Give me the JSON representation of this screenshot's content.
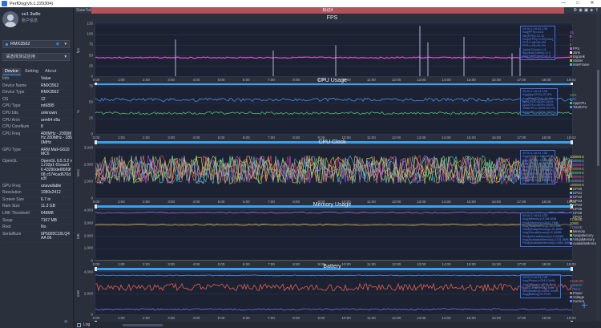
{
  "window": {
    "title": "PerfDog(v6.1.220304)",
    "controls": [
      "—",
      "□",
      "✕"
    ]
  },
  "sidebar": {
    "user": {
      "name": "xe1 3w8e",
      "center": "账户信息"
    },
    "device": {
      "name": "RMX3562"
    },
    "app_placeholder": "请选择测试应用",
    "tabs": [
      "Device",
      "Setting",
      "About"
    ],
    "info_header": {
      "k": "Info",
      "v": "Value"
    },
    "info": [
      {
        "k": "Device Name",
        "v": "RMX3562"
      },
      {
        "k": "Device Type",
        "v": "RMX3562"
      },
      {
        "k": "OS",
        "v": "12"
      },
      {
        "k": "CPU Type",
        "v": "mt6895"
      },
      {
        "k": "CPU bits",
        "v": "unknown"
      },
      {
        "k": "CPU Arch",
        "v": "arm64-v8a"
      },
      {
        "k": "CPU CoreNum",
        "v": "8"
      },
      {
        "k": "CPU Freq",
        "v": "400MHz - 2000MHz 200MHz - 2850MHz"
      },
      {
        "k": "GPU Type",
        "v": "ARM Mali-G610 MC6"
      },
      {
        "k": "OpenGL",
        "v": "OpenGL ES 3.2 v1.r32p1-01eac0.6 43290de6f069f08 c574cad670de3f"
      },
      {
        "k": "GPU Freq",
        "v": "unavailable"
      },
      {
        "k": "Resolution",
        "v": "1080x2412"
      },
      {
        "k": "Screen Size",
        "v": "6.7 in"
      },
      {
        "k": "Ram Size",
        "v": "11.3 GB"
      },
      {
        "k": "LMK Threshold",
        "v": "648MB"
      },
      {
        "k": "Swap",
        "v": "7167 MB"
      },
      {
        "k": "Root",
        "v": "No"
      },
      {
        "k": "SerialNum",
        "v": "6P5005C10LQ4AA 06"
      }
    ]
  },
  "main": {
    "state_tab": "StateTab",
    "record_tag": "标记4",
    "x_ticks": [
      "0:00",
      "1:00",
      "2:00",
      "3:00",
      "4:00",
      "5:00",
      "6:00",
      "7:00",
      "8:00",
      "9:00",
      "10:00",
      "11:00",
      "12:00",
      "13:00",
      "14:00",
      "15:00",
      "16:00",
      "17:00",
      "18:00",
      "19:03"
    ],
    "panels": [
      {
        "title": "FPS",
        "ylabel": "fps",
        "yticks": [
          "125",
          "100",
          "75",
          "50",
          "25",
          "0"
        ],
        "stats": [
          "00:00-1:16:41.138",
          "Avg(FPS)=44.8",
          "Var(FPS)=12.11",
          "Drop(FPS)=0.90[/10m]",
          "FPS>=18=99.3%",
          "FPS>=25=99.0%",
          "Jank(/10min)=1.6",
          "BigJank(/10min)=0.4",
          "Avg(InterFrame)=0.0"
        ],
        "legend": [
          {
            "value": "45",
            "label": "FPS",
            "color": "#e04fd8"
          },
          {
            "value": "0",
            "label": "Jank",
            "color": "#e8e8e8"
          },
          {
            "value": "0",
            "label": "BigJank",
            "color": "#d94a4a"
          },
          {
            "value": "0",
            "label": "Stutter",
            "color": "#8fd14f"
          },
          {
            "value": "",
            "label": "InterFrame",
            "color": "#4ab0e8"
          }
        ]
      },
      {
        "title": "CPU Usage",
        "ylabel": "%",
        "yticks": [
          "75",
          "50",
          "25",
          "0"
        ],
        "stats": [
          "00:00-1:16:41.138",
          "Avg(AppCPU)=22.8%",
          "Avg(TotalCPU)=45.4%",
          "AppCPU<=60%=100%",
          "AppCPU<=80%=100%",
          "TotalCPU<=60%=99.7%",
          "TotalCPU<=80%=100%"
        ],
        "legend": [
          {
            "value": "23%",
            "label": "AppCPU",
            "color": "#4fbf6f"
          },
          {
            "value": "48%",
            "label": "TotalCPU",
            "color": "#4a8ff0"
          }
        ]
      },
      {
        "title": "CPU Clock",
        "ylabel": "MHz",
        "yticks": [
          "3,000",
          "2,000",
          "1,000",
          "0"
        ],
        "stats": [
          "00:00-1:16:41.138",
          "Avg(CPU0)=1482MHz",
          "Avg(CPU1)=1482MHz",
          "Avg(CPU2)=1482MHz",
          "Avg(CPU3)=1482MHz",
          "Avg(CPU4)=1729MHz",
          "Avg(CPU5)=1729MHz",
          "Avg(CPU6)=1729MHz",
          "Avg(CPU7)=1729MHz"
        ],
        "legend": [
          {
            "value": "1000MHz",
            "label": "CPU0",
            "color": "#e0e04f"
          },
          {
            "value": "1000MHz",
            "label": "CPU1",
            "color": "#4fbfe0"
          },
          {
            "value": "1000MHz",
            "label": "CPU2",
            "color": "#bf4fe0"
          },
          {
            "value": "1000MHz",
            "label": "CPU3",
            "color": "#e08c4f"
          },
          {
            "value": "1600MHz",
            "label": "CPU4",
            "color": "#4fe0a0"
          },
          {
            "value": "1600MHz",
            "label": "CPU5",
            "color": "#e04f6f"
          },
          {
            "value": "1600MHz",
            "label": "CPU6",
            "color": "#8f8fe8"
          },
          {
            "value": "1600MHz",
            "label": "CPU7",
            "color": "#c8c84f"
          }
        ]
      },
      {
        "title": "Memory Usage",
        "ylabel": "MB",
        "yticks": [
          "4,000",
          "3,000",
          "2,000",
          "1,000",
          "0"
        ],
        "stats": [
          "00:00-1:16:41.138",
          "Avg(Memory)=3748.5MB",
          "Peak(Memory)=3917.7MB",
          "Avg(SwapMemory)=30.1MB",
          "Peak(SwapMemory)=31.8MB",
          "Avg(VirtualMemory)=2.40MB",
          "Peak(VirtualMemory)=3.00MB",
          "Avg(AvailableMemory)=2761.3MB",
          "Peak(AvailableMemory)=2980.3MB"
        ],
        "legend": [
          {
            "value": "3748MB",
            "label": "Memory",
            "color": "#e6c74f"
          },
          {
            "value": "30MB",
            "label": "SwapMemory",
            "color": "#8fd14f"
          },
          {
            "value": "",
            "label": "VirtualMemory",
            "color": "#4ab0e8"
          },
          {
            "value": "4745MB",
            "label": "AvailableMemory",
            "color": "#9d6fe0"
          }
        ]
      },
      {
        "title": "Battery",
        "ylabel": "mW",
        "yticks": [
          "4,000",
          "2,000",
          "0"
        ],
        "stats": [
          "00:00-1:16:41.138",
          "Avg(Power)=2341.0mW",
          "Avg(Voltage)=4020.7mV",
          "Avg(Current)=582.3mA",
          "Sum(Battery)=3104.7mWh",
          "Avg(Battery)=5.7%/h"
        ],
        "legend": [
          {
            "value": "2324mW",
            "label": "Power",
            "color": "#e0604f"
          },
          {
            "value": "4015mV",
            "label": "Voltage",
            "color": "#4a8ff0"
          },
          {
            "value": "579mA",
            "label": "Current",
            "color": "#6f6fe0"
          }
        ]
      }
    ]
  },
  "bottom": {
    "log_label": "Log"
  }
}
